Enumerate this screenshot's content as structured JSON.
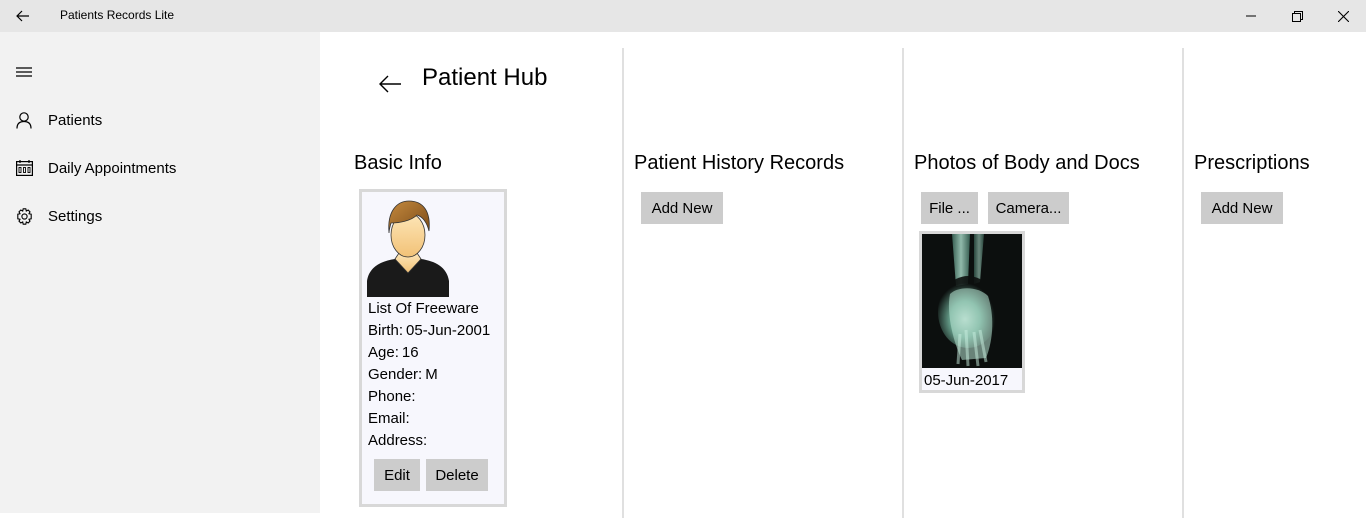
{
  "window": {
    "title": "Patients Records Lite"
  },
  "sidebar": {
    "items": [
      {
        "label": "Patients",
        "icon": "person-icon"
      },
      {
        "label": "Daily Appointments",
        "icon": "calendar-icon"
      },
      {
        "label": "Settings",
        "icon": "gear-icon"
      }
    ]
  },
  "hub": {
    "title": "Patient Hub"
  },
  "sections": {
    "basic_info": {
      "title": "Basic Info",
      "name": "List Of Freeware",
      "birth_label": "Birth:",
      "birth_value": "05-Jun-2001",
      "age_label": "Age:",
      "age_value": "16",
      "gender_label": "Gender:",
      "gender_value": "M",
      "phone_label": "Phone:",
      "email_label": "Email:",
      "address_label": "Address:",
      "edit_label": "Edit",
      "delete_label": "Delete"
    },
    "history": {
      "title": "Patient History Records",
      "add_label": "Add New"
    },
    "photos": {
      "title": "Photos of Body and Docs",
      "file_label": "File ...",
      "camera_label": "Camera...",
      "items": [
        {
          "date": "05-Jun-2017"
        }
      ]
    },
    "prescriptions": {
      "title": "Prescriptions",
      "add_label": "Add New"
    }
  }
}
